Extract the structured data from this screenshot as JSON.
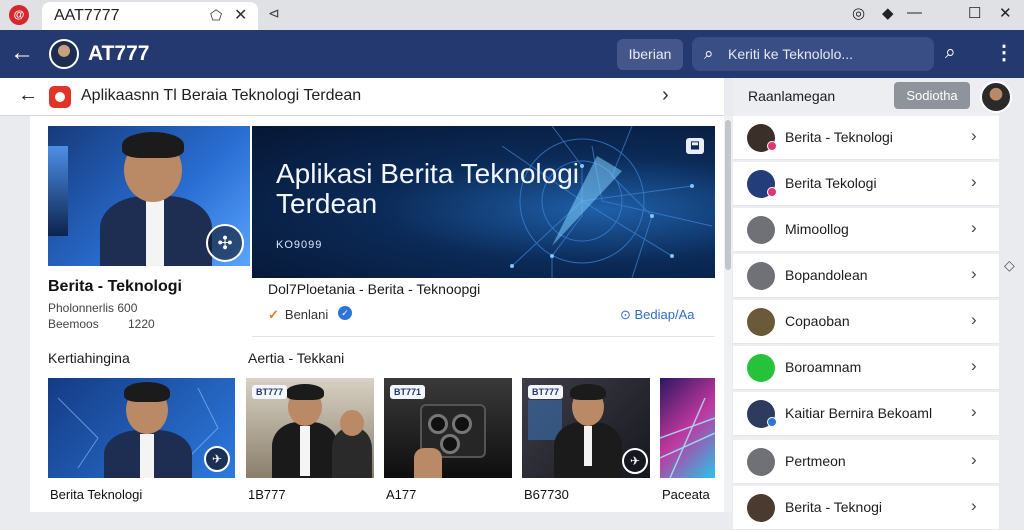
{
  "tabbar": {
    "app_icon_text": "@",
    "tab_title": "AAT7777",
    "tab_pin_icon": "⬠",
    "tab_close": "✕",
    "new_tab": "⊲",
    "window_controls": [
      "◎",
      "◆",
      "—",
      "☐",
      "✕"
    ]
  },
  "header": {
    "title": "AT777",
    "button_label": "Iberian",
    "search_placeholder": "Keriti ke Teknololo..."
  },
  "breadcrumb": {
    "title": "Aplikaasnn Tl Beraia Teknologi Terdean"
  },
  "featured": {
    "title": "Berita - Teknologi",
    "meta1": "Pholonnerlis 600",
    "meta2": "Beemoos",
    "meta3": "1220"
  },
  "banner": {
    "line1": "Aplikasi Berita Teknologi",
    "line2": "Terdean",
    "sub": "KO9099",
    "caption": "Dol7Ploetania  -  Berita - Teknoopgi",
    "author": "Benlani",
    "action": "Bediap/Aa"
  },
  "sections": {
    "left": "Kertiahingina",
    "right": "Aertia - Tekkani"
  },
  "videos": [
    {
      "title": "Berita  Teknologi",
      "badge": ""
    },
    {
      "title": "1B777",
      "badge": "BT777"
    },
    {
      "title": "A177",
      "badge": "BT771"
    },
    {
      "title": "B67730",
      "badge": "BT777"
    },
    {
      "title": "Paceata",
      "badge": ""
    }
  ],
  "panel": {
    "title": "Raanlamegan",
    "button": "Sodiotha",
    "items": [
      {
        "label": "Berita - Teknologi",
        "icon_color": "#3b2f2a",
        "dot_color": "#e0356f"
      },
      {
        "label": "Berita Tekologi",
        "icon_color": "#233d7a",
        "dot_color": "#e0356f"
      },
      {
        "label": "Mimoollog",
        "icon_color": "#6f7176",
        "dot_color": ""
      },
      {
        "label": "Bopandolean",
        "icon_color": "#6f7176",
        "dot_color": ""
      },
      {
        "label": "Copaoban",
        "icon_color": "#6b5a3a",
        "dot_color": ""
      },
      {
        "label": "Boroamnam",
        "icon_color": "#27c23c",
        "dot_color": ""
      },
      {
        "label": "Kaitiar Bernira Bekoaml",
        "icon_color": "#2d3b5e",
        "dot_color": "#2e74d6"
      },
      {
        "label": "Pertmeon",
        "icon_color": "#6f7176",
        "dot_color": ""
      },
      {
        "label": "Berita - Teknogi",
        "icon_color": "#4a3a30",
        "dot_color": ""
      }
    ]
  }
}
